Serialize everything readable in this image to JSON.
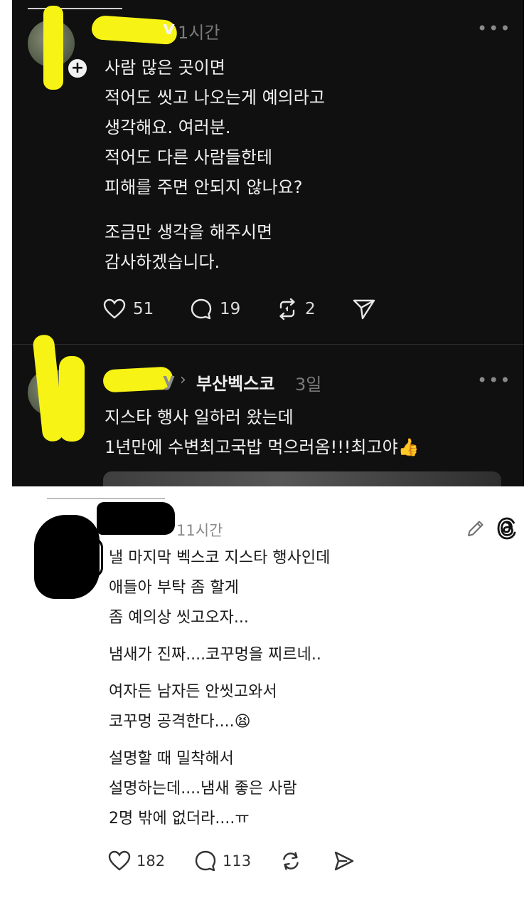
{
  "post1": {
    "username_visible": "v",
    "time": "1시간",
    "more": "•••",
    "body": "사람 많은 곳이면\n적어도 씻고 나오는게 예의라고\n생각해요. 여러분.\n적어도 다른 사람들한테\n피해를 주면 안되지 않나요?",
    "body2": "조금만 생각을 해주시면\n감사하겠습니다.",
    "likes": "51",
    "comments": "19",
    "reposts": "2"
  },
  "post2": {
    "username_visible": "y",
    "community": "부산벡스코",
    "time": "3일",
    "more": "•••",
    "body": "지스타 행사 일하러 왔는데\n1년만에 수변최고국밥 먹으러옴!!!최고야👍"
  },
  "post3": {
    "time": "11시간",
    "p1": "낼 마지막 벡스코 지스타 행사인데\n애들아 부탁 좀 할게\n좀 예의상 씻고오자...",
    "p2": "냄새가 진짜....코꾸멍을 찌르네..",
    "p3": "여자든 남자든 안씻고와서\n코꾸멍 공격한다....😫",
    "p4": "설명할 때 밀착해서\n설명하는데....냄새 좋은 사람\n2명 밖에 없더라....ㅠ",
    "likes": "182",
    "comments": "113"
  },
  "icons": {
    "heart": "heart-icon",
    "comment": "comment-icon",
    "repost": "repost-icon",
    "share": "share-icon",
    "edit": "pencil-icon",
    "threads": "threads-logo-icon",
    "follow": "plus-icon"
  },
  "colors": {
    "dark_bg": "#101010",
    "highlighter_yellow": "#f7f315",
    "light_bg": "#ffffff"
  }
}
